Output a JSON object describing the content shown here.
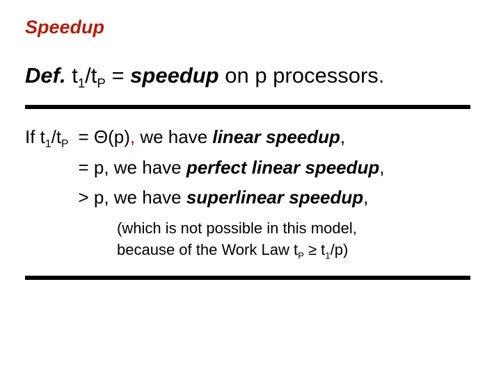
{
  "title": "Speedup",
  "def": {
    "label": "Def.",
    "lhs_pre": "t",
    "lhs_sub1": "1",
    "lhs_mid": "/t",
    "lhs_sub2": "P",
    "eq": " = ",
    "speedup": "speedup",
    "tail": "  on p processors."
  },
  "cases": {
    "prefix": "If t",
    "prefix_sub1": "1",
    "prefix_mid": "/t",
    "prefix_sub2": "P",
    "rows": [
      {
        "op": "= Θ(p)",
        "comma_red": true,
        "pre": " we have ",
        "term": "linear speedup",
        "post": ","
      },
      {
        "op": "= p,",
        "comma_red": false,
        "pre": " we have ",
        "term": "perfect linear speedup",
        "post": ","
      },
      {
        "op": "> p,",
        "comma_red": false,
        "pre": " we have ",
        "term": "superlinear speedup",
        "post": ","
      }
    ]
  },
  "note": {
    "line1": "(which is not possible in this model,",
    "line2_pre": " because of the Work Law t",
    "line2_subP": "P",
    "line2_mid": " ≥ t",
    "line2_sub1": "1",
    "line2_tail": "/p)"
  }
}
